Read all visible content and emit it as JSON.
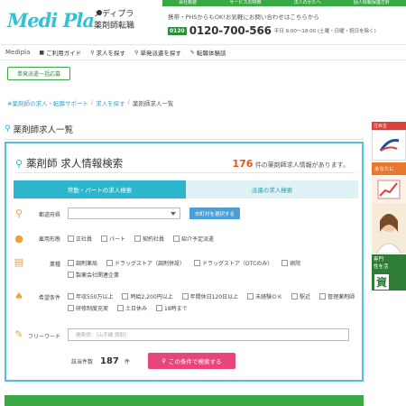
{
  "topbar": {
    "links": [
      "会社概要",
      "サービスの特徴",
      "法人のかたへ",
      "個人情報保護方針"
    ]
  },
  "header": {
    "logo_text": "Medi Pla",
    "brand_line1": "メディプラ",
    "brand_line2": "薬剤師転職",
    "note": "携帯・PHSからもOK!お気軽にお問い合わせはこちらから",
    "free_badge": "0120",
    "phone": "0120-700-566",
    "hours": "平日 9:00～18:00 (土曜・日曜・祝日を除く)"
  },
  "nav": {
    "brand": "Medipla",
    "items": [
      "ご利用ガイド",
      "求人を探す",
      "単発派遣を探す",
      "転職体験談"
    ]
  },
  "bulk_button": "単発派遣一括応募",
  "breadcrumb": [
    "#薬剤師の求人・転職サポート",
    "求人を探す",
    "薬剤師求人一覧"
  ],
  "page_title": "薬剤師求人一覧",
  "search": {
    "title": "薬剤師 求人情報検索",
    "count": "176",
    "count_suffix": "件の薬剤師求人情報があります。",
    "tabs": [
      "常勤・パートの求人検索",
      "派遣の求人検索"
    ],
    "pref_label": "都道府県",
    "muni_button": "市町村を選択する",
    "employment_label": "雇用形態",
    "employment_options": [
      "正社員",
      "パート",
      "契約社員",
      "紹介予定派遣"
    ],
    "facility_label": "業種",
    "facility_options": [
      "調剤薬局",
      "ドラッグストア（調剤併設）",
      "ドラッグストア（OTCのみ）",
      "病院",
      "製薬会社関連企業"
    ],
    "conditions_label": "希望条件",
    "conditions_options": [
      "年収550万以上",
      "時給2,200円以上",
      "年間休日120日以上",
      "未経験ＯＫ",
      "駅近",
      "管理薬剤師",
      "研修制度充実",
      "土日休み",
      "18時まで"
    ],
    "freeword_label": "フリーワード",
    "freeword_placeholder": "検索例：［山手線 調剤］",
    "result_label": "該当件数",
    "result_count": "187",
    "result_unit": "件",
    "search_button": "この条件で検索する"
  },
  "rail": {
    "badge": "注目企",
    "orange": "あなたに",
    "green_line1": "専門",
    "green_line2": "性を活",
    "green_char": "資"
  },
  "colors": {
    "accent": "#2cb5cc",
    "brand_green": "#3aa845",
    "search_button": "#e8457a",
    "count": "#e0561a"
  }
}
